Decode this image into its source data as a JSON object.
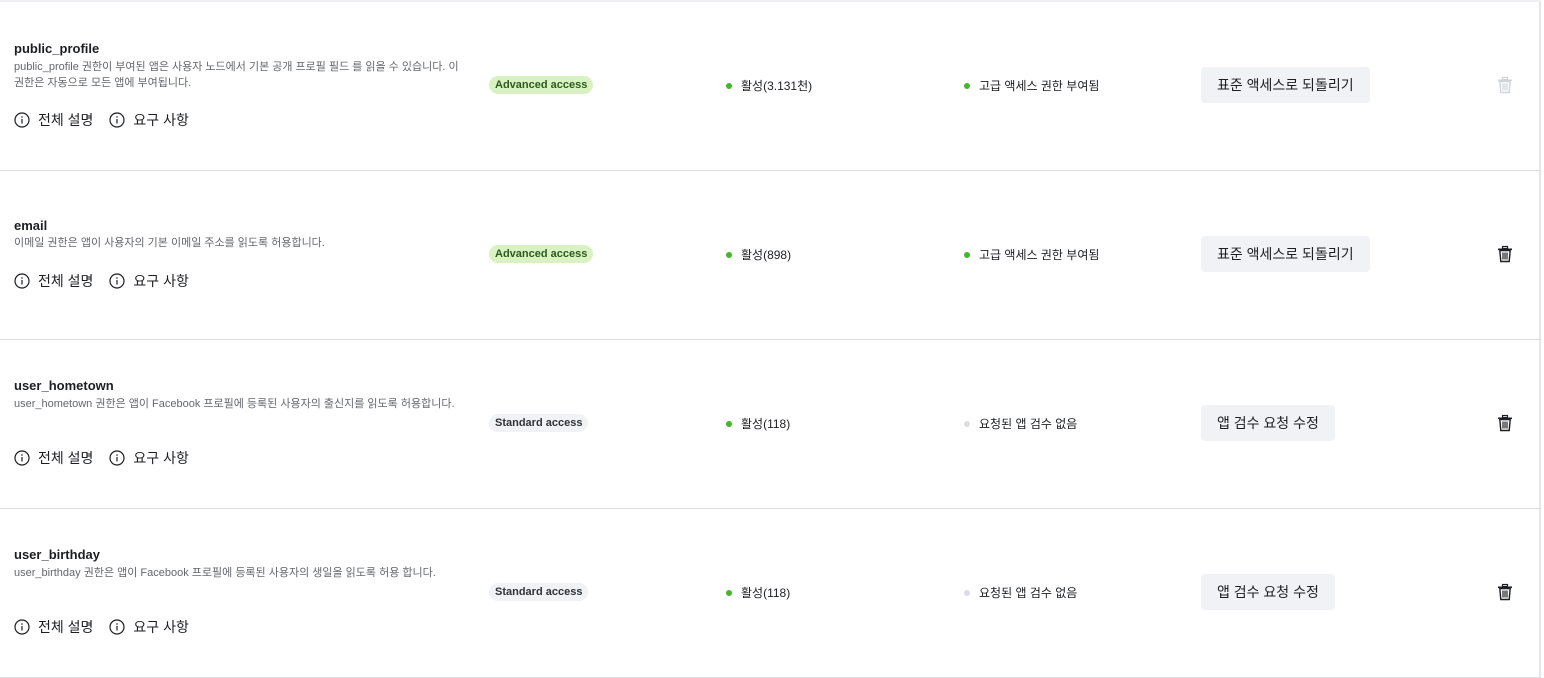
{
  "permissions": [
    {
      "name": "public_profile",
      "description": "public_profile 권한이 부여된 앱은 사용자 노드에서 기본 공개 프로필 필드 를 읽을 수 있습니다. 이 권한은 자동으로 모든 앱에 부여됩니다.",
      "full_description_label": "전체 설명",
      "requirements_label": "요구 사항",
      "access_badge": "Advanced access",
      "access_level": "advanced",
      "activity_status": "활성(3.131천)",
      "activity_dot_color": "#42b72a",
      "review_status": "고급 액세스 권한 부여됨",
      "review_dot_color": "#42b72a",
      "action_label": "표준 액세스로 되돌리기",
      "delete_disabled": true
    },
    {
      "name": "email",
      "description": "이메일 권한은 앱이 사용자의 기본 이메일 주소를 읽도록 허용합니다.",
      "full_description_label": "전체 설명",
      "requirements_label": "요구 사항",
      "access_badge": "Advanced access",
      "access_level": "advanced",
      "activity_status": "활성(898)",
      "activity_dot_color": "#42b72a",
      "review_status": "고급 액세스 권한 부여됨",
      "review_dot_color": "#42b72a",
      "action_label": "표준 액세스로 되돌리기",
      "delete_disabled": false
    },
    {
      "name": "user_hometown",
      "description": "user_hometown 권한은 앱이 Facebook 프로필에 등록된 사용자의 출신지를 읽도록 허용합니다.",
      "full_description_label": "전체 설명",
      "requirements_label": "요구 사항",
      "access_badge": "Standard access",
      "access_level": "standard",
      "activity_status": "활성(118)",
      "activity_dot_color": "#42b72a",
      "review_status": "요청된 앱 검수 없음",
      "review_dot_color": "#dadde1",
      "action_label": "앱 검수 요청 수정",
      "delete_disabled": false
    },
    {
      "name": "user_birthday",
      "description": "user_birthday 권한은 앱이 Facebook 프로필에 등록된 사용자의 생일을 읽도록 허용 합니다.",
      "full_description_label": "전체 설명",
      "requirements_label": "요구 사항",
      "access_badge": "Standard access",
      "access_level": "standard",
      "activity_status": "활성(118)",
      "activity_dot_color": "#42b72a",
      "review_status": "요청된 앱 검수 없음",
      "review_dot_color": "#dadde1",
      "action_label": "앱 검수 요청 수정",
      "delete_disabled": false
    }
  ],
  "icons": {
    "info": "info-circle-icon",
    "delete": "trash-icon"
  }
}
